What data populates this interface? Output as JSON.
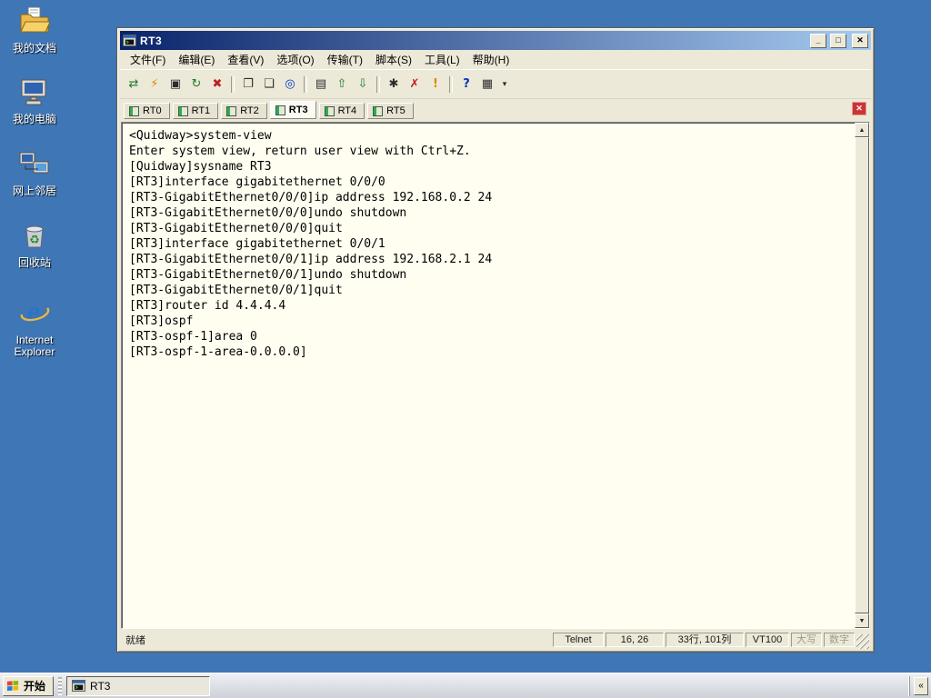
{
  "theme": {
    "desktop_bg": "#3F76B5",
    "titlebar_start": "#0A246A",
    "titlebar_end": "#A6CAF0",
    "window_face": "#ECE9D8",
    "terminal_bg": "#FFFEF0",
    "terminal_fg": "#000000",
    "tab_close_red": "#CC3333"
  },
  "desktop": {
    "icons": [
      {
        "label": "我的文档"
      },
      {
        "label": "我的电脑"
      },
      {
        "label": "网上邻居"
      },
      {
        "label": "回收站"
      },
      {
        "label": "Internet Explorer"
      }
    ]
  },
  "window": {
    "title": "RT3",
    "controls": {
      "minimize": "_",
      "maximize": "□",
      "close": "✕"
    },
    "menus": [
      "文件(F)",
      "编辑(E)",
      "查看(V)",
      "选项(O)",
      "传输(T)",
      "脚本(S)",
      "工具(L)",
      "帮助(H)"
    ],
    "toolbar": [
      {
        "name": "connect",
        "glyph": "⇄"
      },
      {
        "name": "quick-connect",
        "glyph": "⚡"
      },
      {
        "name": "tab-connect",
        "glyph": "▣"
      },
      {
        "name": "reconnect",
        "glyph": "↻"
      },
      {
        "name": "disconnect",
        "glyph": "✖"
      },
      {
        "name": "copy",
        "glyph": "❐"
      },
      {
        "name": "paste",
        "glyph": "❏"
      },
      {
        "name": "find",
        "glyph": "◎"
      },
      {
        "name": "print",
        "glyph": "▤"
      },
      {
        "name": "send-file",
        "glyph": "⇧"
      },
      {
        "name": "receive-file",
        "glyph": "⇩"
      },
      {
        "name": "properties",
        "glyph": "✱"
      },
      {
        "name": "keymap",
        "glyph": "✗"
      },
      {
        "name": "bell",
        "glyph": "!"
      },
      {
        "name": "help",
        "glyph": "?"
      },
      {
        "name": "session-manager",
        "glyph": "▦"
      },
      {
        "name": "overflow",
        "glyph": "▾"
      }
    ],
    "tabs": [
      {
        "label": "RT0",
        "active": false
      },
      {
        "label": "RT1",
        "active": false
      },
      {
        "label": "RT2",
        "active": false
      },
      {
        "label": "RT3",
        "active": true
      },
      {
        "label": "RT4",
        "active": false
      },
      {
        "label": "RT5",
        "active": false
      }
    ],
    "tab_close": "✕",
    "scrollbar": {
      "up": "▲",
      "down": "▼"
    },
    "terminal": {
      "lines": [
        "<Quidway>system-view",
        "Enter system view, return user view with Ctrl+Z.",
        "[Quidway]sysname RT3",
        "[RT3]interface gigabitethernet 0/0/0",
        "[RT3-GigabitEthernet0/0/0]ip address 192.168.0.2 24",
        "[RT3-GigabitEthernet0/0/0]undo shutdown",
        "[RT3-GigabitEthernet0/0/0]quit",
        "[RT3]interface gigabitethernet 0/0/1",
        "[RT3-GigabitEthernet0/0/1]ip address 192.168.2.1 24",
        "[RT3-GigabitEthernet0/0/1]undo shutdown",
        "[RT3-GigabitEthernet0/0/1]quit",
        "[RT3]router id 4.4.4.4",
        "[RT3]ospf",
        "[RT3-ospf-1]area 0",
        "[RT3-ospf-1-area-0.0.0.0]"
      ]
    },
    "status": {
      "ready": "就绪",
      "protocol": "Telnet",
      "cursor": "16, 26",
      "size": "33行, 101列",
      "emulation": "VT100",
      "caps": "大写",
      "num": "数字"
    }
  },
  "taskbar": {
    "start_label": "开始",
    "items": [
      {
        "label": "RT3"
      }
    ],
    "overflow": "«"
  }
}
